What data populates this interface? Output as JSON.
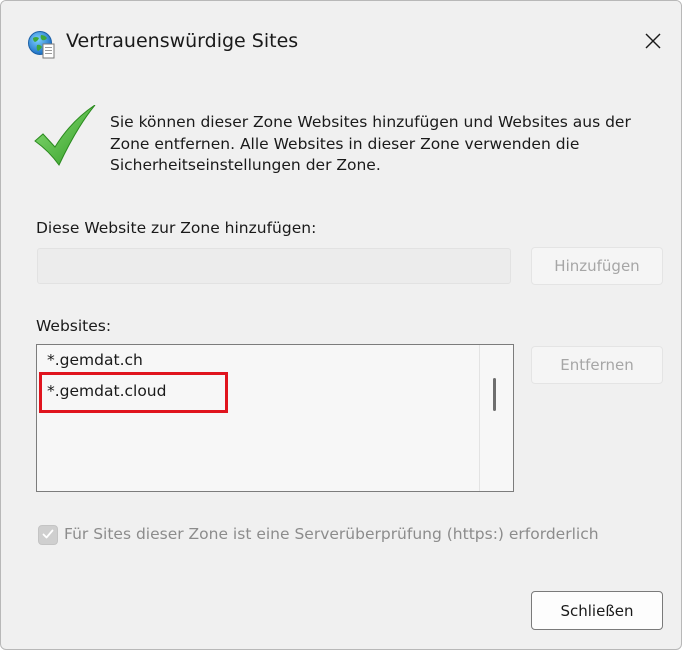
{
  "dialog": {
    "title": "Vertrauenswürdige Sites",
    "icon": "globe-page-icon",
    "close_icon": "close-icon"
  },
  "info": {
    "icon": "green-checkmark-icon",
    "text": "Sie können dieser Zone Websites hinzufügen und Websites aus der Zone entfernen. Alle Websites in dieser Zone verwenden die Sicherheitseinstellungen der Zone."
  },
  "add_site": {
    "label": "Diese Website zur Zone hinzufügen:",
    "value": "",
    "button_label": "Hinzufügen",
    "button_enabled": false
  },
  "websites": {
    "label": "Websites:",
    "items": [
      "*.gemdat.ch",
      "*.gemdat.cloud"
    ],
    "highlighted_item": "*.gemdat.cloud",
    "highlight_color": "#e0141e",
    "remove_button_label": "Entfernen",
    "remove_button_enabled": false
  },
  "https_check": {
    "label": "Für Sites dieser Zone ist eine Serverüberprüfung (https:) erforderlich",
    "checked": true,
    "enabled": false
  },
  "footer": {
    "close_button_label": "Schließen"
  },
  "colors": {
    "window_bg": "#f0f0f0",
    "check_green": "#3fae2a",
    "disabled_text": "#a6a6a6"
  }
}
